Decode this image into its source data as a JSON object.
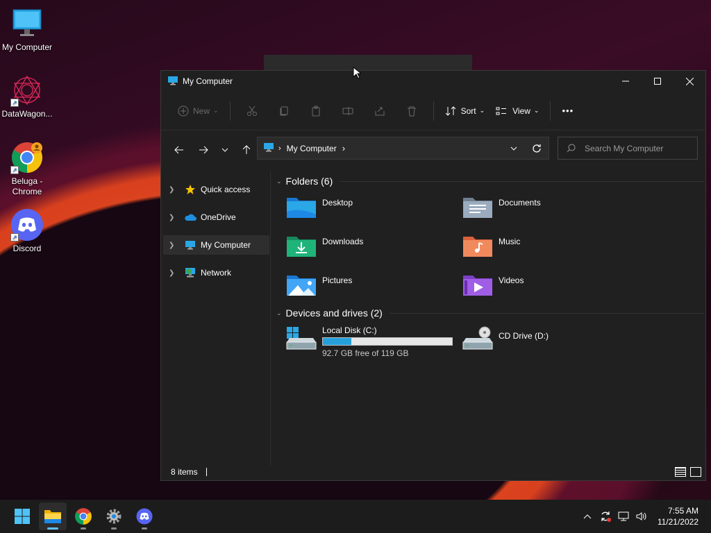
{
  "desktop": {
    "icons": [
      {
        "label": "My Computer"
      },
      {
        "label": "DataWagon..."
      },
      {
        "label": "Beluga - Chrome"
      },
      {
        "label": "Discord"
      }
    ]
  },
  "window": {
    "title": "My Computer",
    "toolbar": {
      "new_label": "New",
      "sort_label": "Sort",
      "view_label": "View",
      "more_label": "•••"
    },
    "address": {
      "crumb": "My Computer"
    },
    "search": {
      "placeholder": "Search My Computer"
    },
    "sidebar": {
      "items": [
        {
          "label": "Quick access"
        },
        {
          "label": "OneDrive"
        },
        {
          "label": "My Computer"
        },
        {
          "label": "Network"
        }
      ]
    },
    "folders": {
      "heading": "Folders (6)",
      "items": [
        {
          "label": "Desktop"
        },
        {
          "label": "Documents"
        },
        {
          "label": "Downloads"
        },
        {
          "label": "Music"
        },
        {
          "label": "Pictures"
        },
        {
          "label": "Videos"
        }
      ]
    },
    "drives": {
      "heading": "Devices and drives (2)",
      "items": [
        {
          "label": "Local Disk (C:)",
          "free_text": "92.7 GB free of 119 GB",
          "used_fraction": 0.22
        },
        {
          "label": "CD Drive (D:)"
        }
      ]
    },
    "status": {
      "items_count": "8 items"
    }
  },
  "taskbar": {
    "clock_time": "7:55 AM",
    "clock_date": "11/21/2022"
  },
  "colors": {
    "accent": "#26a0da",
    "window_bg": "#202020",
    "taskbar_bg": "#1c1c1c"
  }
}
